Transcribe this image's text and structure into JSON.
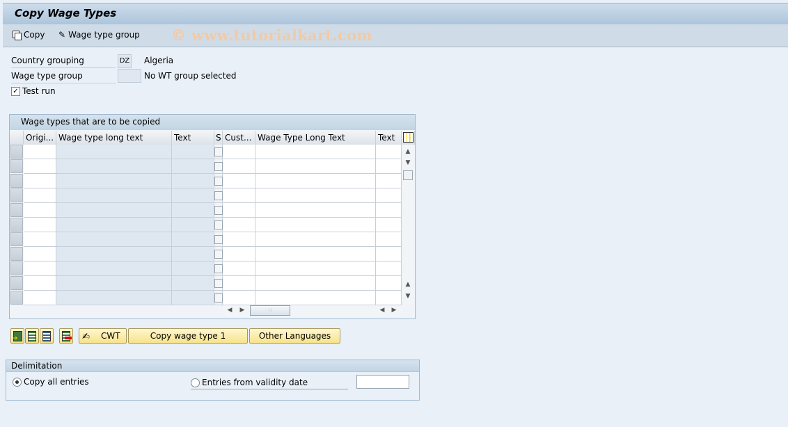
{
  "window": {
    "title": "Copy Wage Types"
  },
  "toolbar": {
    "copy_label": "Copy",
    "wage_type_group_label": "Wage type group",
    "watermark": "© www.tutorialkart.com"
  },
  "form": {
    "country_grouping_label": "Country grouping",
    "country_grouping_value": "DZ",
    "country_grouping_text": "Algeria",
    "wage_type_group_label": "Wage type group",
    "wage_type_group_value": "",
    "wage_type_group_text": "No WT group selected",
    "test_run_label": "Test run",
    "test_run_checked": true
  },
  "table": {
    "title": "Wage types that are to be copied",
    "columns": [
      "Origi...",
      "Wage type long text",
      "Text",
      "S",
      "Cust...",
      "Wage Type Long Text",
      "Text"
    ],
    "row_count": 11,
    "rows": []
  },
  "buttons": {
    "cwt_label": "CWT",
    "copy_wage_type_label": "Copy wage type 1",
    "other_languages_label": "Other Languages"
  },
  "delimitation": {
    "title": "Delimitation",
    "copy_all_label": "Copy all entries",
    "copy_all_selected": true,
    "validity_label": "Entries from validity date",
    "validity_selected": false,
    "validity_date": ""
  }
}
